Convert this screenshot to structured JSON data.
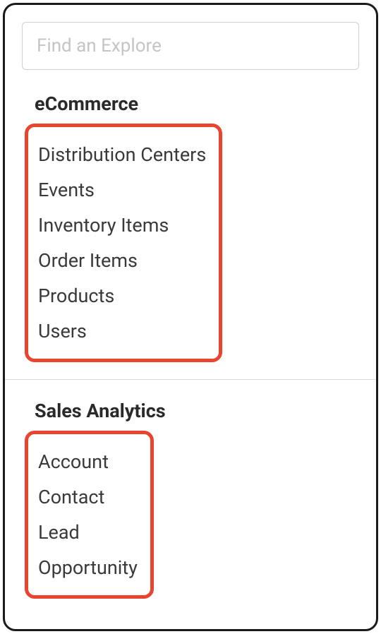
{
  "search": {
    "placeholder": "Find an Explore"
  },
  "sections": [
    {
      "title": "eCommerce",
      "items": [
        "Distribution Centers",
        "Events",
        "Inventory Items",
        "Order Items",
        "Products",
        "Users"
      ]
    },
    {
      "title": "Sales Analytics",
      "items": [
        "Account",
        "Contact",
        "Lead",
        "Opportunity"
      ]
    }
  ]
}
